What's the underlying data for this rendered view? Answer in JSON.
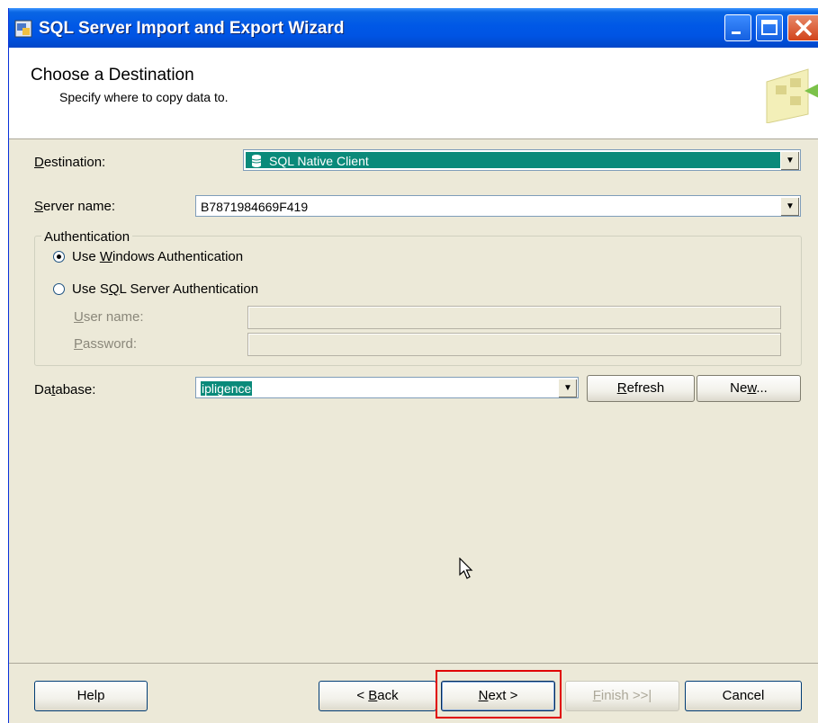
{
  "window": {
    "title": "SQL Server Import and Export Wizard"
  },
  "header": {
    "title": "Choose a Destination",
    "subtitle": "Specify where to copy data to."
  },
  "destination": {
    "label_u": "D",
    "label_rest": "estination:",
    "value": "SQL Native Client"
  },
  "server": {
    "label_u": "S",
    "label_rest": "erver name:",
    "value": "B7871984669F419"
  },
  "authentication": {
    "legend": "Authentication",
    "windows": {
      "pre": "Use ",
      "u": "W",
      "post": "indows Authentication",
      "selected": true
    },
    "sql": {
      "pre": "Use S",
      "u": "Q",
      "post": "L Server Authentication",
      "selected": false
    },
    "username": {
      "u": "U",
      "rest": "ser name:",
      "value": ""
    },
    "password": {
      "u": "P",
      "rest": "assword:",
      "value": ""
    }
  },
  "database": {
    "pre": "Da",
    "u": "t",
    "post": "abase:",
    "value": "ipligence"
  },
  "buttons": {
    "refresh": {
      "u": "R",
      "rest": "efresh"
    },
    "new": {
      "pre": "Ne",
      "u": "w",
      "post": "..."
    },
    "help": "Help",
    "back": {
      "pre": "< ",
      "u": "B",
      "post": "ack"
    },
    "next": {
      "u": "N",
      "post": "ext >"
    },
    "finish": {
      "u": "F",
      "post": "inish >>|"
    },
    "cancel": "Cancel"
  },
  "colors": {
    "titlebar": "#0054e3",
    "dialog": "#ece9d8",
    "selection": "#0a8a7a",
    "highlight": "#e00000"
  },
  "icons": [
    "wizard-app-icon",
    "minimize-icon",
    "maximize-icon",
    "close-icon",
    "wizard-header-icon",
    "database-icon",
    "dropdown-arrow-icon",
    "mouse-cursor-icon"
  ]
}
